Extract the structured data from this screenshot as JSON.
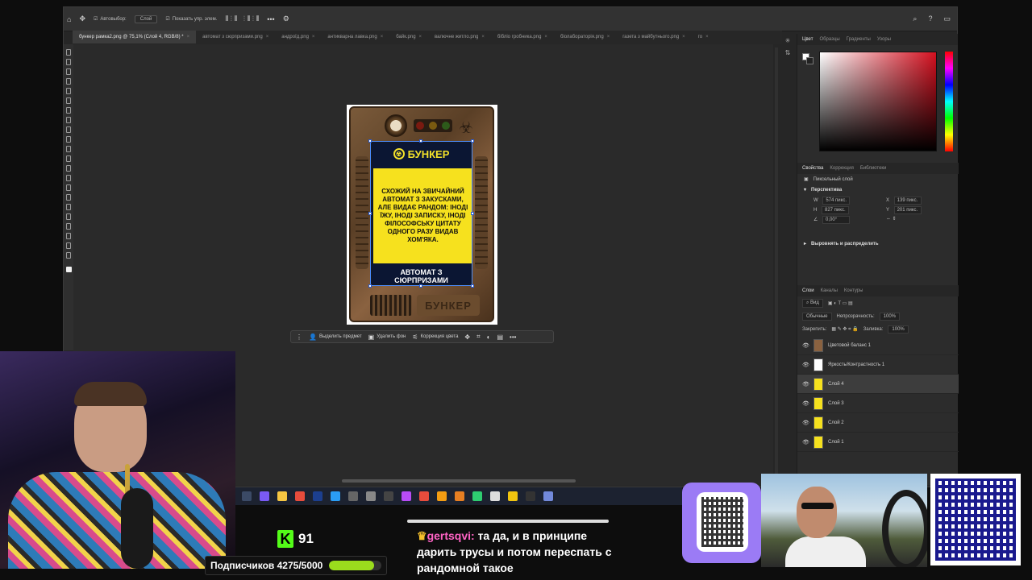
{
  "photoshop": {
    "options_bar": {
      "autoselect_label": "Автовыбор:",
      "autoselect_value": "Слой",
      "show_controls_label": "Показать упр. элем."
    },
    "tabs": [
      {
        "label": "бункер рамка2.png @ 75,1% (Слой 4, RGB/8) *",
        "active": true
      },
      {
        "label": "автомат з сюрпризами.png",
        "active": false
      },
      {
        "label": "андроїд.png",
        "active": false
      },
      {
        "label": "антикварна лавка.png",
        "active": false
      },
      {
        "label": "байк.png",
        "active": false
      },
      {
        "label": "валючне житло.png",
        "active": false
      },
      {
        "label": "бібліо гробника.png",
        "active": false
      },
      {
        "label": "біолабораторія.png",
        "active": false
      },
      {
        "label": "газета з майбутнього.png",
        "active": false
      },
      {
        "label": "го",
        "active": false
      }
    ],
    "artwork": {
      "title": "БУНКЕР",
      "body": "СХОЖИЙ НА ЗВИЧАЙНИЙ АВТОМАТ З ЗАКУСКАМИ, АЛЕ ВИДАЄ РАНДОМ: ІНОДІ ЇЖУ, ІНОДІ ЗАПИСКУ, ІНОДІ ФІЛОСОФСЬКУ ЦИТАТУ ОДНОГО РАЗУ ВИДАВ ХОМ'ЯКА.",
      "footer": "АВТОМАТ З СЮРПРИЗАМИ",
      "plate": "БУНКЕР"
    },
    "context_bar": {
      "select_subject": "Выделить предмет",
      "remove_bg": "Удалить фон",
      "color_correction": "Коррекция цвета"
    },
    "color_panel": {
      "tabs": [
        "Цвет",
        "Образцы",
        "Градиенты",
        "Узоры"
      ]
    },
    "properties_panel": {
      "tabs": [
        "Свойства",
        "Коррекция",
        "Библиотеки"
      ],
      "layer_type": "Пиксельный слой",
      "transform_header": "Перспектива",
      "w": "574 пикс.",
      "h": "827 пикс.",
      "x": "139 пикс.",
      "y": "201 пикс.",
      "angle": "0,00°",
      "align_header": "Выровнять и распределить"
    },
    "layers_panel": {
      "tabs": [
        "Слои",
        "Каналы",
        "Контуры"
      ],
      "filter": "Вид",
      "blend_mode": "Обычные",
      "opacity_label": "Непрозрачность:",
      "opacity": "100%",
      "lock_label": "Закрепить:",
      "fill_label": "Заливка:",
      "fill": "100%",
      "layers": [
        {
          "name": "Цветовой баланс 1",
          "thumb": "brown",
          "selected": false
        },
        {
          "name": "Яркость/Контрастность 1",
          "thumb": "white",
          "selected": false
        },
        {
          "name": "Слой 4",
          "thumb": "yellow",
          "selected": true
        },
        {
          "name": "Слой 3",
          "thumb": "yellow",
          "selected": false
        },
        {
          "name": "Слой 2",
          "thumb": "yellow",
          "selected": false
        },
        {
          "name": "Слой 1",
          "thumb": "yellow",
          "selected": false
        }
      ]
    }
  },
  "stream": {
    "kick_count": "91",
    "subs_label": "Подписчиков 4275/5000",
    "subs_progress": 0.855,
    "chat_user": "gertsqvi:",
    "chat_message": " та да, и в принципе дарить трусы и потом переспать с рандомной такое",
    "colors": {
      "accent_green": "#9bdc1d",
      "kick_green": "#53fc18",
      "chat_user": "#ff63c4"
    }
  }
}
